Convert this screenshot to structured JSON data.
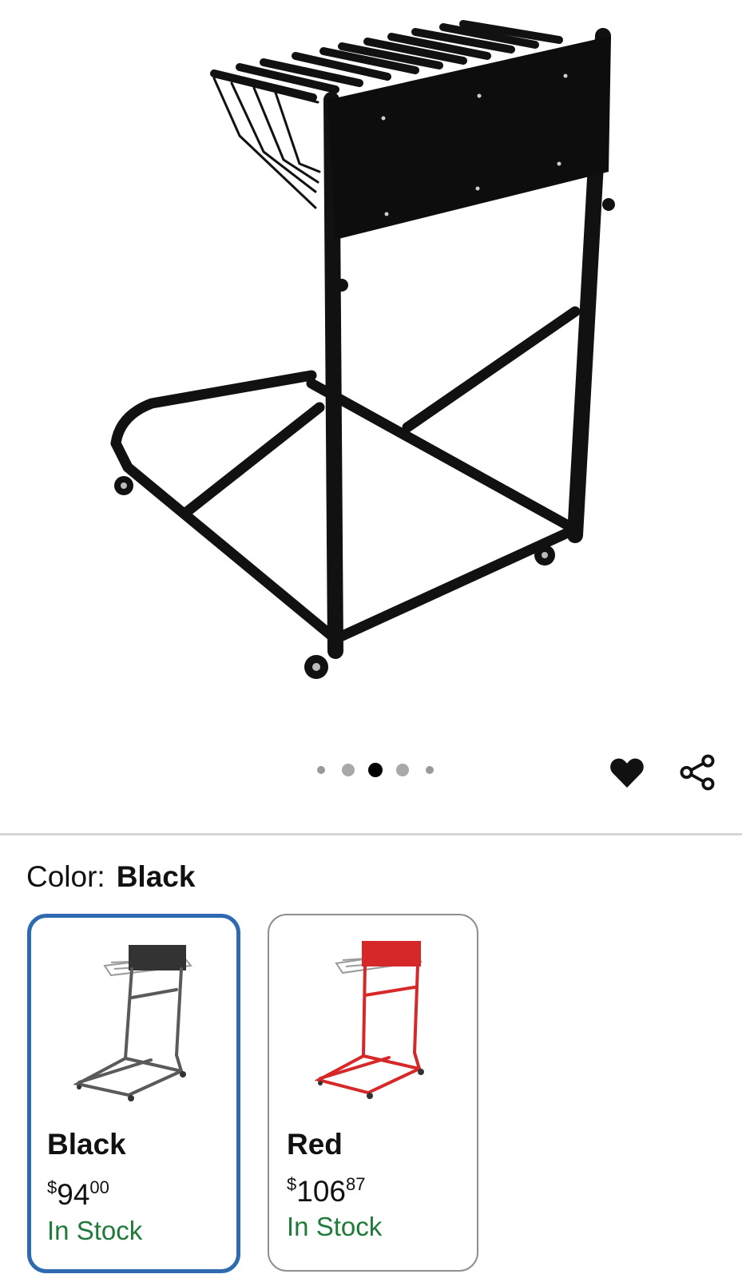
{
  "product_image": {
    "icon": "rolling-plan-rack-photo",
    "carousel": {
      "count": 5,
      "active_index": 2
    }
  },
  "actions": {
    "favorite_icon": "heart-icon",
    "share_icon": "share-icon"
  },
  "color_selector": {
    "label": "Color:",
    "selected_value": "Black",
    "options": [
      {
        "name": "Black",
        "currency": "$",
        "price_whole": "94",
        "price_cents": "00",
        "stock": "In Stock",
        "frame_color": "#5a5a5a",
        "selected": true
      },
      {
        "name": "Red",
        "currency": "$",
        "price_whole": "106",
        "price_cents": "87",
        "stock": "In Stock",
        "frame_color": "#d62828",
        "selected": false
      }
    ]
  },
  "colors": {
    "selected_border": "#2e6ab0",
    "stock_green": "#1f7a3a",
    "active_dot": "#000000",
    "inactive_dot": "#9a9a9a"
  }
}
